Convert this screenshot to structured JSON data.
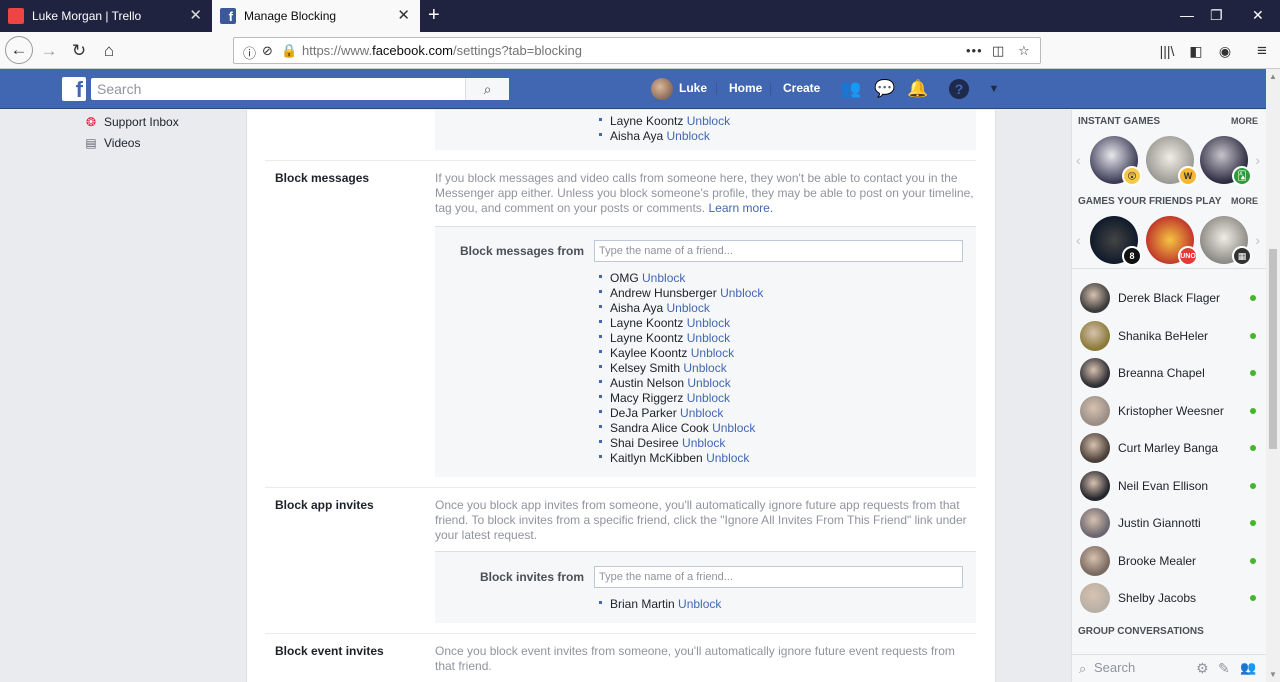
{
  "browser": {
    "tabs": [
      {
        "title": "Luke Morgan | Trello",
        "active": false
      },
      {
        "title": "Manage Blocking",
        "active": true
      }
    ],
    "url_prefix": "https://www.",
    "url_domain": "facebook.com",
    "url_path": "/settings?tab=blocking"
  },
  "fb": {
    "search_placeholder": "Search",
    "user_name": "Luke",
    "nav_home": "Home",
    "nav_create": "Create"
  },
  "left": {
    "items": [
      {
        "label": "Support Inbox",
        "icon": "lifebuoy-icon"
      },
      {
        "label": "Videos",
        "icon": "film-icon"
      }
    ]
  },
  "unblock_label": "Unblock",
  "top_list": [
    "Layne Koontz",
    "Aisha Aya"
  ],
  "block_messages": {
    "title": "Block messages",
    "desc": "If you block messages and video calls from someone here, they won't be able to contact you in the Messenger app either. Unless you block someone's profile, they may be able to post on your timeline, tag you, and comment on your posts or comments.",
    "learn_more": "Learn more.",
    "label": "Block messages from",
    "placeholder": "Type the name of a friend...",
    "list": [
      "OMG",
      "Andrew Hunsberger",
      "Aisha Aya",
      "Layne Koontz",
      "Layne Koontz",
      "Kaylee Koontz",
      "Kelsey Smith",
      "Austin Nelson",
      "Macy Riggerz",
      "DeJa Parker",
      "Sandra Alice Cook",
      "Shai Desiree",
      "Kaitlyn McKibben"
    ]
  },
  "block_app_invites": {
    "title": "Block app invites",
    "desc": "Once you block app invites from someone, you'll automatically ignore future app requests from that friend. To block invites from a specific friend, click the \"Ignore All Invites From This Friend\" link under your latest request.",
    "label": "Block invites from",
    "placeholder": "Type the name of a friend...",
    "list": [
      "Brian Martin"
    ]
  },
  "block_event_invites": {
    "title": "Block event invites",
    "desc": "Once you block event invites from someone, you'll automatically ignore future event requests from that friend."
  },
  "right": {
    "instant_games": "INSTANT GAMES",
    "more": "MORE",
    "games_friends_play": "GAMES YOUR FRIENDS PLAY",
    "group_conversations": "GROUP CONVERSATIONS",
    "search_placeholder": "Search",
    "friends": [
      "Derek Black Flager",
      "Shanika BeHeler",
      "Breanna Chapel",
      "Kristopher Weesner",
      "Curt Marley Banga",
      "Neil Evan Ellison",
      "Justin Giannotti",
      "Brooke Mealer",
      "Shelby Jacobs"
    ],
    "game_badges_1": [
      "😲",
      "W",
      "🂡"
    ],
    "game_badges_2": [
      "8",
      "UNO",
      "▦"
    ]
  }
}
